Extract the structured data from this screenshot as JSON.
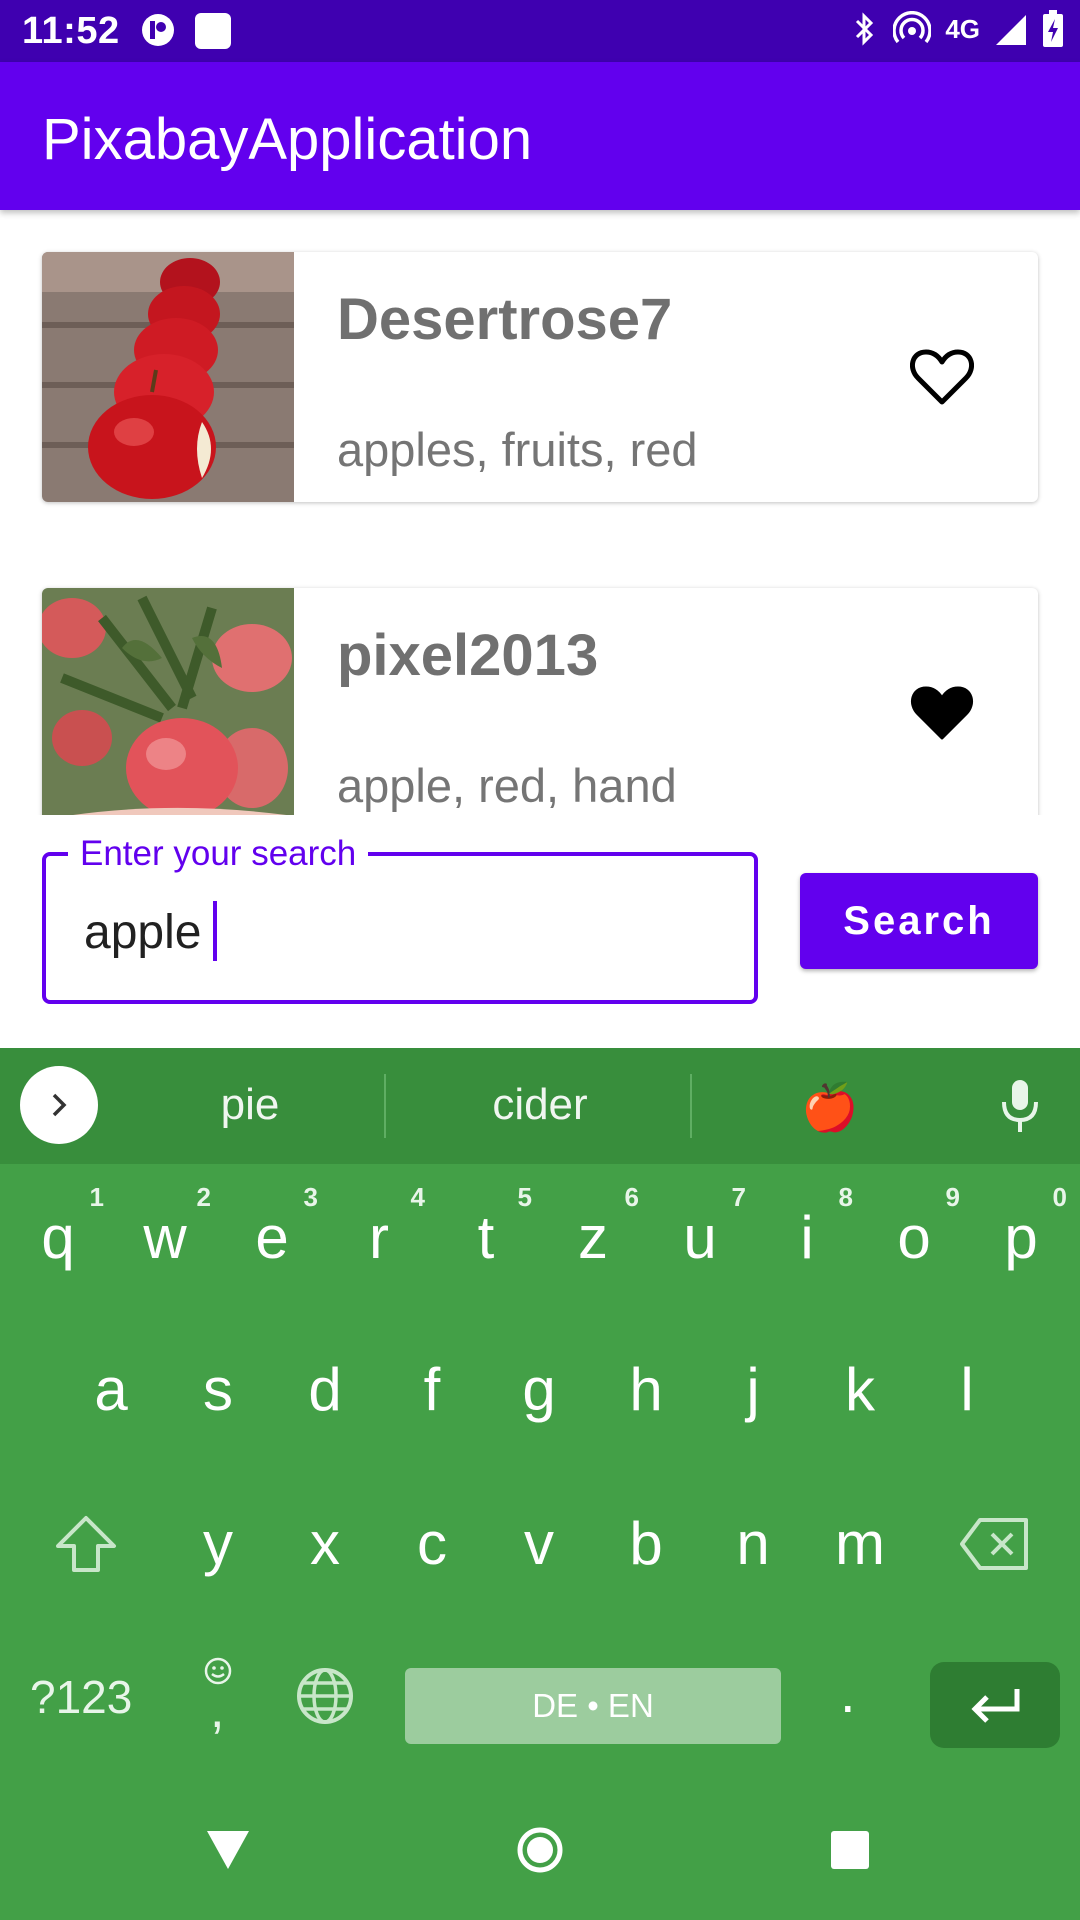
{
  "status_bar": {
    "time": "11:52",
    "network": "4G"
  },
  "app_bar": {
    "title": "PixabayApplication"
  },
  "results": [
    {
      "user": "Desertrose7",
      "tags": "apples, fruits, red",
      "favorite": false,
      "favorite_icon": "heart-outline-icon"
    },
    {
      "user": "pixel2013",
      "tags": "apple, red, hand",
      "favorite": true,
      "favorite_icon": "heart-filled-icon"
    }
  ],
  "search": {
    "label": "Enter your search",
    "value": "apple",
    "button_label": "Search"
  },
  "keyboard": {
    "suggestions": [
      "pie",
      "cider",
      "🍎"
    ],
    "row1": [
      {
        "ch": "q",
        "hint": "1"
      },
      {
        "ch": "w",
        "hint": "2"
      },
      {
        "ch": "e",
        "hint": "3"
      },
      {
        "ch": "r",
        "hint": "4"
      },
      {
        "ch": "t",
        "hint": "5"
      },
      {
        "ch": "z",
        "hint": "6"
      },
      {
        "ch": "u",
        "hint": "7"
      },
      {
        "ch": "i",
        "hint": "8"
      },
      {
        "ch": "o",
        "hint": "9"
      },
      {
        "ch": "p",
        "hint": "0"
      }
    ],
    "row2": [
      "a",
      "s",
      "d",
      "f",
      "g",
      "h",
      "j",
      "k",
      "l"
    ],
    "row3": [
      "y",
      "x",
      "c",
      "v",
      "b",
      "n",
      "m"
    ],
    "symbols_label": "?123",
    "comma_label": ",",
    "space_label": "DE • EN",
    "period_label": "."
  },
  "colors": {
    "status_bar": "#3f00b0",
    "primary": "#6200ee",
    "keyboard": "#43a047",
    "keyboard_suggestions": "#388e3c"
  }
}
